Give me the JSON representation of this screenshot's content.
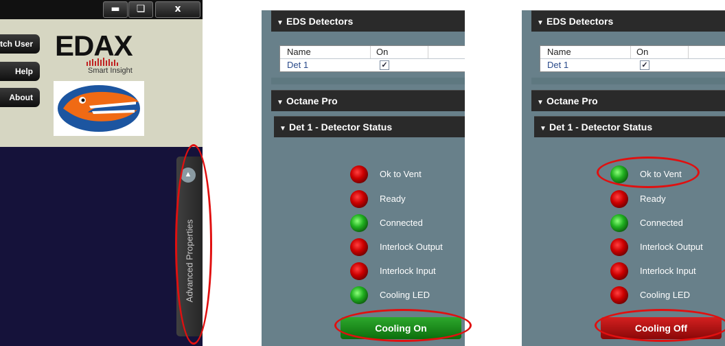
{
  "window": {
    "minimize_label": "‗",
    "restore_label": "🗗",
    "close_label": "x"
  },
  "sidebar": {
    "buttons": [
      "tch User",
      "Help",
      "About"
    ]
  },
  "logo": {
    "brand": "EDAX",
    "tagline": "Smart Insight",
    "mascot_icon": "florida-gators-logo"
  },
  "advanced_panel": {
    "tab_label": "Advanced Properties",
    "expand_icon": "chevron-up-icon"
  },
  "detector_panels": [
    {
      "eds_header": "EDS Detectors",
      "table": {
        "columns": [
          "Name",
          "On"
        ],
        "rows": [
          {
            "name": "Det 1",
            "on": true
          }
        ]
      },
      "octane_header": "Octane Pro",
      "status_header": "Det 1 - Detector Status",
      "statuses": [
        {
          "label": "Ok to Vent",
          "color": "red"
        },
        {
          "label": "Ready",
          "color": "red"
        },
        {
          "label": "Connected",
          "color": "green"
        },
        {
          "label": "Interlock Output",
          "color": "red"
        },
        {
          "label": "Interlock Input",
          "color": "red"
        },
        {
          "label": "Cooling LED",
          "color": "green"
        }
      ],
      "cooling_button": "Cooling On",
      "cooling_button_color": "#1a8a1a"
    },
    {
      "eds_header": "EDS Detectors",
      "table": {
        "columns": [
          "Name",
          "On"
        ],
        "rows": [
          {
            "name": "Det 1",
            "on": true
          }
        ]
      },
      "octane_header": "Octane Pro",
      "status_header": "Det 1 - Detector Status",
      "statuses": [
        {
          "label": "Ok to Vent",
          "color": "green"
        },
        {
          "label": "Ready",
          "color": "red"
        },
        {
          "label": "Connected",
          "color": "green"
        },
        {
          "label": "Interlock Output",
          "color": "red"
        },
        {
          "label": "Interlock Input",
          "color": "red"
        },
        {
          "label": "Cooling LED",
          "color": "red"
        }
      ],
      "cooling_button": "Cooling Off",
      "cooling_button_color": "#b01010"
    }
  ],
  "annotation_color": "#e01010"
}
